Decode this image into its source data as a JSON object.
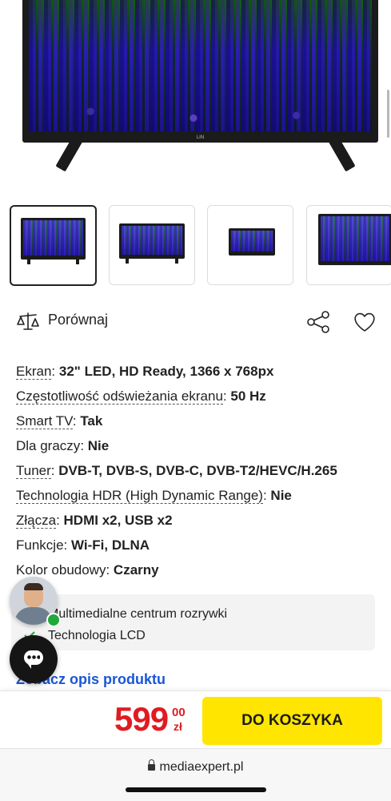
{
  "product_image": {
    "brand_logo": "LIN"
  },
  "thumbnails": {
    "count": 4,
    "selected_index": 0
  },
  "actions": {
    "compare_label": "Porównaj",
    "compare_icon": "scale-icon",
    "share_icon": "share-icon",
    "wishlist_icon": "heart-icon"
  },
  "specs": [
    {
      "key": "Ekran",
      "value": "32\" LED, HD Ready, 1366 x 768px"
    },
    {
      "key": "Częstotliwość odświeżania ekranu",
      "value": "50 Hz"
    },
    {
      "key": "Smart TV",
      "value": "Tak"
    },
    {
      "key": "Dla graczy",
      "value": "Nie"
    },
    {
      "key": "Tuner",
      "value": "DVB-T, DVB-S, DVB-C, DVB-T2/HEVC/H.265"
    },
    {
      "key": "Technologia HDR (High Dynamic Range)",
      "value": "Nie"
    },
    {
      "key": "Złącza",
      "value": "HDMI x2, USB x2"
    },
    {
      "key": "Funkcje",
      "value": "Wi-Fi, DLNA"
    },
    {
      "key": "Kolor obudowy",
      "value": "Czarny"
    }
  ],
  "features": [
    {
      "label": "Multimedialne centrum rozrywki"
    },
    {
      "label": "Technologia LCD"
    }
  ],
  "description_link": "Zobacz opis produktu",
  "price": {
    "main": "599",
    "cents": "00",
    "currency": "zł",
    "color": "#e01b22"
  },
  "cart_button": {
    "label": "DO KOSZYKA",
    "color": "#ffe500"
  },
  "browser": {
    "url": "mediaexpert.pl"
  },
  "colors": {
    "link": "#1a56d6",
    "online": "#1faa3a"
  }
}
